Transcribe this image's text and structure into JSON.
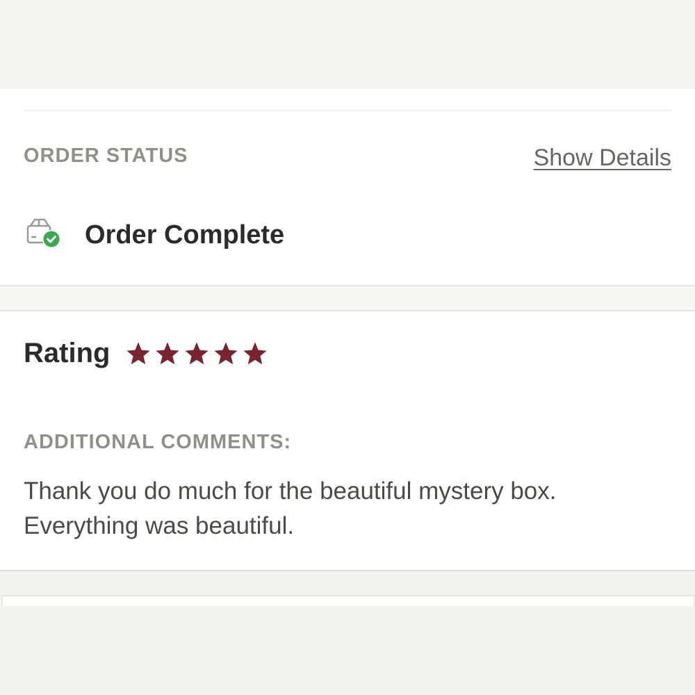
{
  "order_status": {
    "section_label": "ORDER STATUS",
    "show_details_label": "Show Details",
    "status_text": "Order Complete",
    "status_icon": "package-check-icon"
  },
  "rating": {
    "label": "Rating",
    "stars_filled": 5,
    "stars_total": 5,
    "star_color": "#7c2330"
  },
  "comments": {
    "section_label": "ADDITIONAL COMMENTS:",
    "text_line1": "Thank you do much for the beautiful mystery box.",
    "text_line2": "Everything was beautiful."
  },
  "colors": {
    "success_badge": "#3aa84c",
    "label_gray": "#8f8f8c"
  }
}
